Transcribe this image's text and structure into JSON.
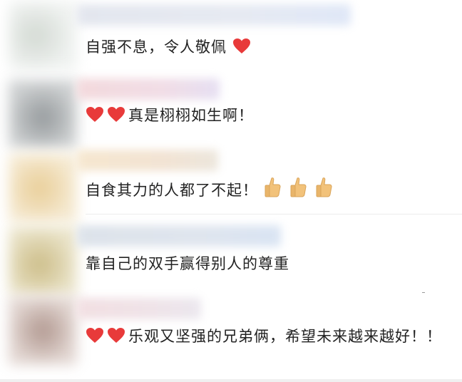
{
  "comments": [
    {
      "text": "自强不息，令人敬佩",
      "prefix_icons": [],
      "suffix_icons": [
        "heart-icon"
      ]
    },
    {
      "text": "真是栩栩如生啊！",
      "prefix_icons": [
        "heart-icon",
        "heart-icon"
      ],
      "suffix_icons": []
    },
    {
      "text": "自食其力的人都了不起！",
      "prefix_icons": [],
      "suffix_icons": [
        "thumbs-up-icon",
        "thumbs-up-icon",
        "thumbs-up-icon"
      ]
    },
    {
      "text": "靠自己的双手赢得别人的尊重",
      "prefix_icons": [],
      "suffix_icons": []
    },
    {
      "text": "乐观又坚强的兄弟俩，希望未来越来越好！！",
      "prefix_icons": [
        "heart-icon",
        "heart-icon"
      ],
      "suffix_icons": []
    }
  ],
  "colors": {
    "heart": "#e83a3a",
    "thumb": "#f2c27a",
    "text": "#222222",
    "divider": "#ececec"
  }
}
